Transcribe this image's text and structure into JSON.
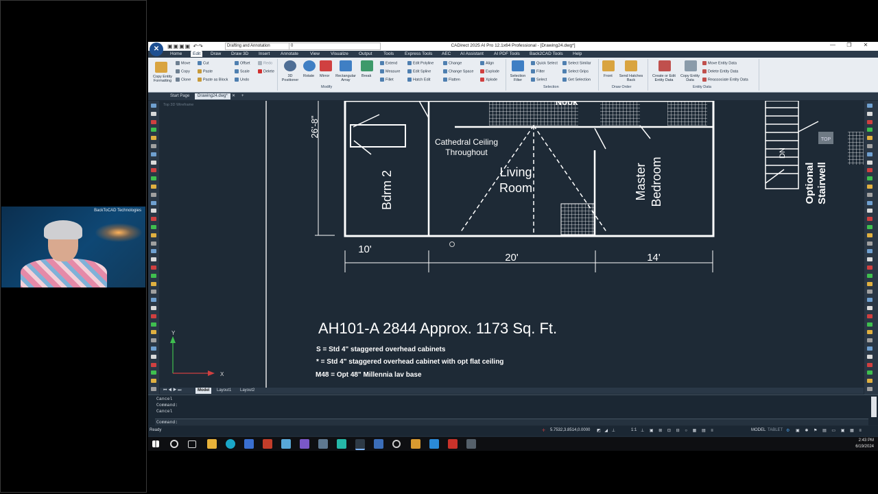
{
  "webcam": {
    "brand": "BackToCAD Technologies"
  },
  "titlebar": {
    "workspace": "Drafting and Annotation",
    "layer": "0",
    "title": "CADirect 2025 AI Pro 12.1x64 Professional - [Drawing24.dwg*]",
    "window_controls": [
      "—",
      "❐",
      "✕"
    ]
  },
  "menu": [
    "Home",
    "Edit",
    "Draw",
    "Draw 3D",
    "Insert",
    "Annotate",
    "View",
    "Visualize",
    "Output",
    "Tools",
    "Express Tools",
    "AEC",
    "AI Assistant",
    "AI PDF Tools",
    "Back2CAD Tools",
    "Help"
  ],
  "menu_active": "Edit",
  "ribbon": {
    "copy_entity_formatting": "Copy Entity Formatting",
    "clipboard": [
      "Move",
      "Copy",
      "Clone",
      "Cut",
      "Paste",
      "Paste as Block",
      "Offset",
      "Scale",
      "Undo",
      "Redo",
      "Delete"
    ],
    "modify_big": [
      "3D Positioner",
      "Rotate",
      "Mirror",
      "Rectangular Array",
      "Break"
    ],
    "modify_small": [
      "Extend",
      "Measure",
      "Fillet",
      "Edit Polyline",
      "Edit Spline",
      "Hatch Edit",
      "Change",
      "Change Space",
      "Flatten",
      "Align",
      "Explode",
      "Xplode"
    ],
    "modify_group": "Modify",
    "selection_filter": "Selection Filter",
    "selection_small": [
      "Quick Select",
      "Filter",
      "Select",
      "Select Similar",
      "Select Grips",
      "Get Selection"
    ],
    "selection_group": "Selection",
    "front": "Front",
    "send_hatches_back": "Send Hatches Back",
    "draw_order_group": "Draw Order",
    "create_edit_entity": "Create or Edit Entity Data",
    "copy_entity_data": "Copy Entity Data",
    "entity_small": [
      "Move Entity Data",
      "Delete Entity Data",
      "Reassociate Entity Data"
    ],
    "entity_group": "Entity Data"
  },
  "doc_tabs": [
    "Start Page",
    "Drawing24.dwg*"
  ],
  "doc_tab_close": "✕",
  "doc_tab_add": "+",
  "viewport_label": "Top  3D Wireframe",
  "drawing": {
    "dim_height": "26'-8\"",
    "bdrm2": "Bdrm 2",
    "cathedral_1": "Cathedral Ceiling",
    "cathedral_2": "Throughout",
    "living_1": "Living",
    "living_2": "Room",
    "master_1": "Master",
    "master_2": "Bedroom",
    "nook": "Nook",
    "optional_1": "Optional",
    "optional_2": "Stairwell",
    "dn": "DN",
    "dim_10": "10'",
    "dim_20": "20'",
    "dim_14": "14'",
    "model_title": "AH101-A 2844  Approx. 1173 Sq. Ft.",
    "note1": "S = Std  4\" staggered overhead cabinets",
    "note2": "* = Std 4\" staggered overhead cabinet with opt flat ceiling",
    "note3": "M48 = Opt  48\" Millennia lav base",
    "viewcube": "TOP",
    "ucs_y": "Y",
    "ucs_x": "X"
  },
  "layout_tabs": [
    "Model",
    "Layout1",
    "Layout2"
  ],
  "command_history": [
    "Cancel",
    "Command:",
    "Cancel"
  ],
  "command_prompt": "Command:",
  "status": {
    "ready": "Ready",
    "coords": "5.7532,3.8514,0.0000",
    "scale": "1:1",
    "model": "MODEL",
    "tablet": "TABLET"
  },
  "clock": {
    "time": "2:43 PM",
    "date": "6/19/2024"
  }
}
